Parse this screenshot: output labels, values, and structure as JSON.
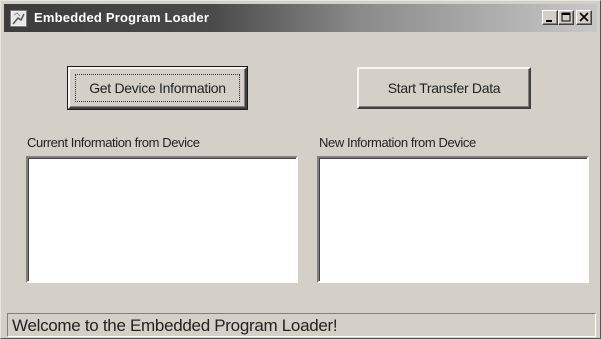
{
  "window": {
    "title": "Embedded Program Loader",
    "icon": "app-loader-icon",
    "controls": [
      "minimize-icon",
      "maximize-icon",
      "close-icon"
    ]
  },
  "buttons": {
    "get_device_info": "Get Device Information",
    "start_transfer": "Start Transfer Data"
  },
  "panels": {
    "current_label": "Current Information from Device",
    "new_label": "New Information from Device"
  },
  "status": {
    "message": "Welcome to the Embedded Program Loader!"
  },
  "colors": {
    "face": "#d4d0c8",
    "title_start": "#3c3c3c",
    "title_end": "#c8c8c8",
    "field": "#ffffff"
  }
}
